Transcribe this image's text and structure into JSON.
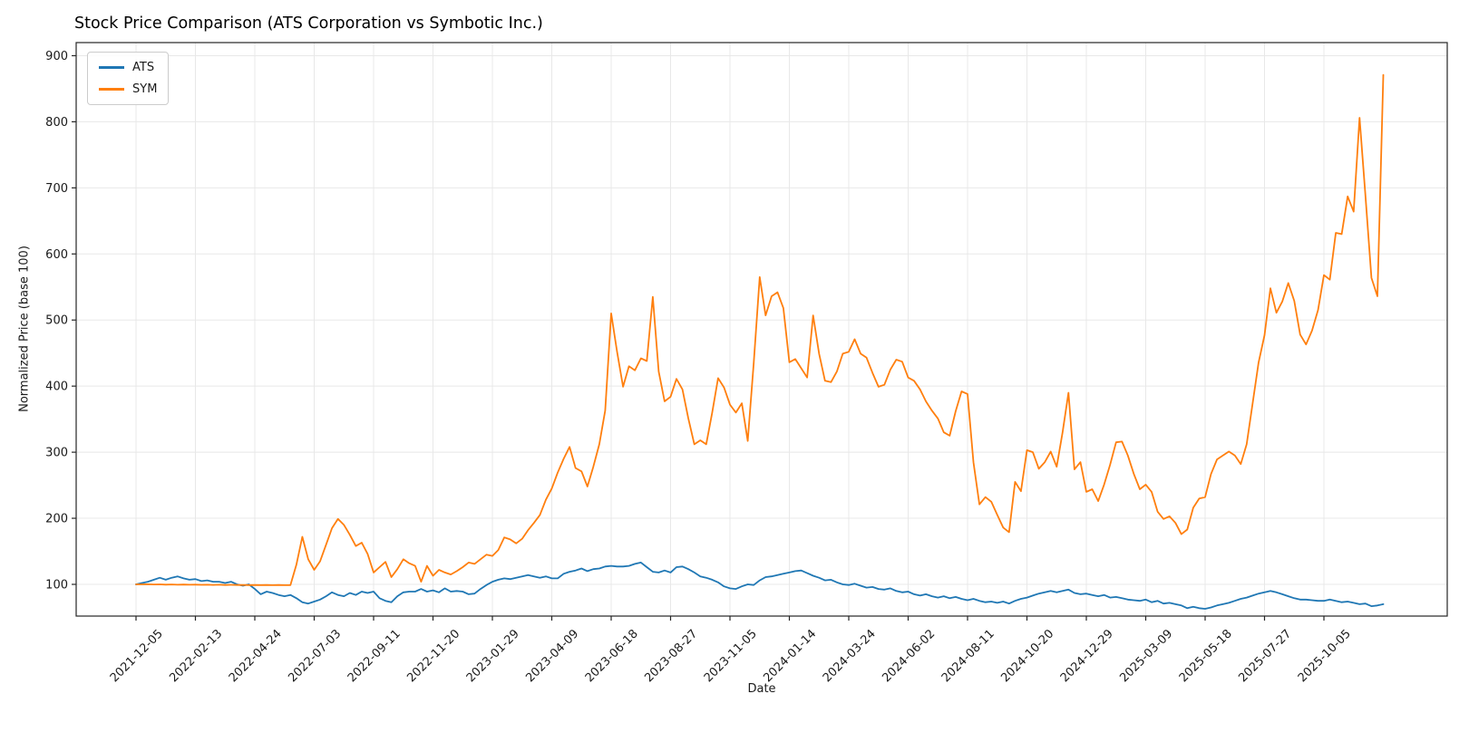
{
  "chart_data": {
    "type": "line",
    "title": "Stock Price Comparison (ATS Corporation vs Symbotic Inc.)",
    "xlabel": "Date",
    "ylabel": "Normalized Price (base 100)",
    "legend_position": "upper left",
    "grid": true,
    "x_start_date": "2021-12-05",
    "x_interval_days": 7,
    "x_tick_step": 10,
    "x_tick_labels": [
      "2021-12-05",
      "2022-02-13",
      "2022-04-24",
      "2022-07-03",
      "2022-09-11",
      "2022-11-20",
      "2023-01-29",
      "2023-04-09",
      "2023-06-18",
      "2023-08-27",
      "2023-11-05",
      "2024-01-14",
      "2024-03-24",
      "2024-06-02",
      "2024-08-11",
      "2024-10-20",
      "2024-12-29",
      "2025-03-09",
      "2025-05-18",
      "2025-07-27",
      "2025-10-05"
    ],
    "y_ticks": [
      100,
      200,
      300,
      400,
      500,
      600,
      700,
      800,
      900
    ],
    "ylim": [
      50,
      920
    ],
    "series": [
      {
        "name": "ATS",
        "color": "#1f77b4",
        "values": [
          100,
          102,
          104,
          107,
          110,
          107,
          110,
          112,
          109,
          107,
          108,
          105,
          106,
          104,
          104,
          102,
          104,
          100,
          98,
          100,
          93,
          85,
          89,
          87,
          84,
          82,
          84,
          79,
          73,
          71,
          74,
          77,
          82,
          88,
          84,
          82,
          87,
          84,
          89,
          87,
          89,
          79,
          75,
          73,
          82,
          88,
          89,
          89,
          93,
          89,
          91,
          88,
          94,
          89,
          90,
          89,
          85,
          86,
          93,
          99,
          104,
          107,
          109,
          108,
          110,
          112,
          114,
          112,
          110,
          112,
          109,
          109,
          116,
          119,
          121,
          124,
          120,
          123,
          124,
          127,
          128,
          127,
          127,
          128,
          131,
          133,
          126,
          119,
          118,
          121,
          118,
          126,
          127,
          123,
          118,
          112,
          110,
          107,
          103,
          97,
          94,
          93,
          97,
          100,
          99,
          106,
          111,
          112,
          114,
          116,
          118,
          120,
          121,
          117,
          113,
          110,
          106,
          107,
          103,
          100,
          99,
          101,
          98,
          95,
          96,
          93,
          92,
          94,
          90,
          88,
          89,
          85,
          83,
          85,
          82,
          80,
          82,
          79,
          81,
          78,
          76,
          78,
          75,
          73,
          74,
          72,
          74,
          71,
          75,
          78,
          80,
          83,
          86,
          88,
          90,
          88,
          90,
          92,
          87,
          85,
          86,
          84,
          82,
          84,
          80,
          81,
          79,
          77,
          76,
          75,
          77,
          73,
          75,
          71,
          72,
          70,
          68,
          64,
          66,
          64,
          63,
          65,
          68,
          70,
          72,
          75,
          78,
          80,
          83,
          86,
          88,
          90,
          88,
          85,
          82,
          79,
          77,
          77,
          76,
          75,
          75,
          77,
          75,
          73,
          74,
          72,
          70,
          71,
          67,
          68,
          70
        ]
      },
      {
        "name": "SYM",
        "color": "#ff7f0e",
        "values": [
          100,
          100,
          100.2,
          99.8,
          100,
          99.6,
          99.8,
          99.5,
          99.7,
          99.4,
          99.6,
          99.3,
          99.5,
          99.2,
          99.4,
          99.1,
          99.3,
          99,
          99.2,
          98.9,
          99.1,
          98.9,
          99,
          98.8,
          99,
          98.8,
          98.9,
          130,
          172,
          138,
          122,
          135,
          160,
          185,
          199,
          190,
          175,
          158,
          163,
          146,
          118,
          126,
          134,
          111,
          123,
          138,
          132,
          128,
          104,
          128,
          113,
          122,
          118,
          115,
          120,
          126,
          133,
          131,
          138,
          145,
          143,
          152,
          171,
          168,
          162,
          169,
          182,
          193,
          205,
          228,
          245,
          269,
          290,
          308,
          276,
          271,
          248,
          278,
          312,
          363,
          510,
          452,
          399,
          430,
          424,
          442,
          438,
          535,
          422,
          377,
          384,
          411,
          395,
          351,
          312,
          318,
          312,
          360,
          412,
          398,
          372,
          360,
          374,
          317,
          435,
          565,
          507,
          536,
          542,
          518,
          436,
          441,
          427,
          413,
          507,
          449,
          408,
          406,
          422,
          449,
          452,
          471,
          449,
          443,
          420,
          399,
          402,
          425,
          440,
          437,
          413,
          408,
          395,
          377,
          363,
          351,
          330,
          325,
          362,
          392,
          388,
          285,
          221,
          232,
          225,
          205,
          186,
          179,
          255,
          241,
          303,
          300,
          275,
          285,
          301,
          278,
          330,
          390,
          274,
          285,
          240,
          244,
          226,
          251,
          281,
          315,
          316,
          295,
          267,
          244,
          251,
          240,
          210,
          199,
          203,
          193,
          176,
          183,
          216,
          230,
          232,
          267,
          289,
          295,
          301,
          295,
          282,
          312,
          374,
          436,
          477,
          548,
          511,
          528,
          556,
          529,
          478,
          463,
          484,
          515,
          568,
          561,
          632,
          630,
          687,
          664,
          806,
          688,
          564,
          536,
          871
        ]
      }
    ]
  }
}
